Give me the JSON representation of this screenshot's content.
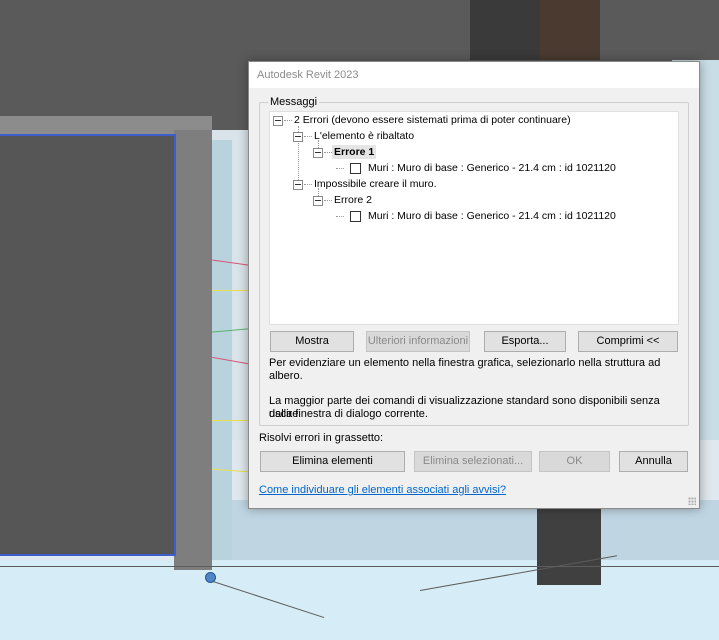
{
  "dialog": {
    "title": "Autodesk Revit 2023",
    "messages_label": "Messaggi",
    "tree": {
      "root": "2 Errori (devono essere sistemati prima di poter continuare)",
      "group1": "L'elemento è ribaltato",
      "error1": "Errore 1",
      "item1": "Muri : Muro di base : Generico - 21.4 cm : id 1021120",
      "group2": "Impossibile creare il muro.",
      "error2": "Errore 2",
      "item2": "Muri : Muro di base : Generico - 21.4 cm : id 1021120"
    },
    "buttons": {
      "show": "Mostra",
      "more_info": "Ulteriori informazioni",
      "export": "Esporta...",
      "collapse": "Comprimi <<"
    },
    "hint1": "Per evidenziare un elemento nella finestra grafica, selezionarlo nella struttura ad albero.",
    "hint2_line1": "La maggior parte dei comandi di visualizzazione standard sono disponibili senza uscire",
    "hint2_line2": "dalla finestra di dialogo corrente.",
    "resolve_label": "Risolvi errori in grassetto:",
    "actions": {
      "delete_elements": "Elimina elementi",
      "delete_selected": "Elimina selezionati...",
      "ok": "OK",
      "cancel": "Annulla"
    },
    "link": "Come individuare gli elementi associati agli avvisi?"
  },
  "colors": {
    "link": "#0066cc",
    "selection_outline": "#3e5fc9",
    "dialog_bg": "#f0f0f0"
  }
}
